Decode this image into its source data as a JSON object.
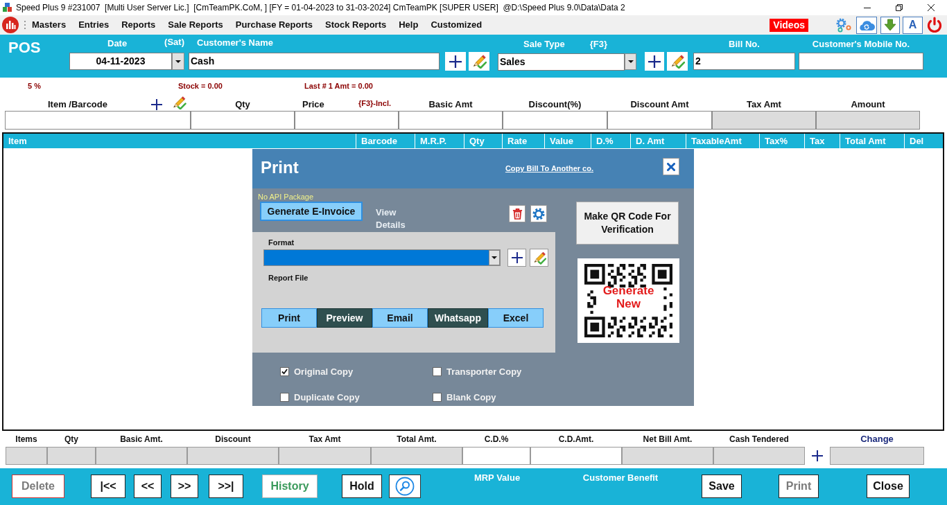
{
  "window": {
    "title": "Speed Plus 9 #231007  [Multi User Server Lic.]  [CmTeamPK.CoM, ] [FY = 01-04-2023 to 31-03-2024] CmTeamPK [SUPER USER]  @D:\\Speed Plus 9.0\\Data\\Data 2"
  },
  "menu": {
    "items": [
      "Masters",
      "Entries",
      "Reports",
      "Sale Reports",
      "Purchase Reports",
      "Stock Reports",
      "Help",
      "Customized"
    ],
    "videos": "Videos",
    "font_button": "A"
  },
  "pos_header": {
    "title": "POS",
    "date": {
      "label": "Date",
      "weekday": "(Sat)",
      "value": "04-11-2023"
    },
    "customer_name": {
      "label": "Customer's Name",
      "value": "Cash"
    },
    "sale_type": {
      "label": "Sale Type",
      "hint": "{F3}",
      "value": "Sales"
    },
    "bill_no": {
      "label": "Bill No.",
      "value": "2"
    },
    "customer_mobile": {
      "label": "Customer's Mobile No."
    }
  },
  "info_line": [
    "5 %",
    "Stock = 0.00",
    "Last # 1 Amt = 0.00"
  ],
  "entry_fields": [
    {
      "label": "Item /Barcode",
      "kind": "lookup",
      "disabled": false
    },
    {
      "label": "Qty",
      "kind": "plain",
      "disabled": false
    },
    {
      "label": "Price",
      "kind": "price",
      "hint": "{F3}-Incl.",
      "disabled": false
    },
    {
      "label": "Basic Amt",
      "kind": "plain",
      "disabled": false
    },
    {
      "label": "Discount(%)",
      "kind": "plain",
      "disabled": false
    },
    {
      "label": "Discount Amt",
      "kind": "plain",
      "disabled": false
    },
    {
      "label": "Tax Amt",
      "kind": "plain",
      "disabled": true
    },
    {
      "label": "Amount",
      "kind": "plain",
      "disabled": true
    }
  ],
  "table": {
    "columns": [
      "Item",
      "Barcode",
      "M.R.P.",
      "Qty",
      "Rate",
      "Value",
      "D.%",
      "D. Amt",
      "TaxableAmt",
      "Tax%",
      "Tax",
      "Total Amt",
      "Del"
    ]
  },
  "print_dialog": {
    "title": "Print",
    "link": "Copy Bill To Another co.",
    "notice": "No API Package",
    "einvoice_button": "Generate E-Invoice",
    "view_details": "View Details",
    "qr_button": "Make QR Code For Verification",
    "qr_image_text": "Generate New",
    "format": {
      "label": "Format",
      "focused": true
    },
    "report_file_label": "Report File",
    "actions": [
      {
        "label": "Print",
        "kind": "light"
      },
      {
        "label": "Preview",
        "kind": "dark"
      },
      {
        "label": "Email",
        "kind": "light"
      },
      {
        "label": "Whatsapp",
        "kind": "dark"
      },
      {
        "label": "Excel",
        "kind": "light"
      }
    ],
    "copies": [
      {
        "label": "Original Copy",
        "checked": true
      },
      {
        "label": "Transporter Copy",
        "checked": false
      },
      {
        "label": "Duplicate Copy",
        "checked": false
      },
      {
        "label": "Blank Copy",
        "checked": false
      }
    ]
  },
  "totals": [
    {
      "label": "Items",
      "kind": "plain",
      "disabled": true
    },
    {
      "label": "Qty",
      "kind": "plain",
      "disabled": true
    },
    {
      "label": "Basic Amt.",
      "kind": "plain",
      "disabled": true
    },
    {
      "label": "Discount",
      "kind": "plain",
      "disabled": true
    },
    {
      "label": "Tax Amt",
      "kind": "plain",
      "disabled": true
    },
    {
      "label": "Total Amt.",
      "kind": "plain",
      "disabled": true
    },
    {
      "label": "C.D.%",
      "kind": "plain",
      "disabled": false
    },
    {
      "label": "C.D.Amt.",
      "kind": "plain",
      "disabled": false
    },
    {
      "label": "Net Bill Amt.",
      "kind": "plain",
      "disabled": true
    },
    {
      "label": "Cash Tendered",
      "kind": "plain",
      "disabled": true
    },
    {
      "label": "Change",
      "kind": "change",
      "disabled": true
    }
  ],
  "footer": [
    {
      "label": "Delete",
      "kind": "danger",
      "disabled": true
    },
    {
      "label": "|<<",
      "kind": "plain",
      "disabled": false
    },
    {
      "label": "<<",
      "kind": "plain",
      "disabled": false
    },
    {
      "label": ">>",
      "kind": "plain",
      "disabled": false
    },
    {
      "label": ">>|",
      "kind": "plain",
      "disabled": false
    },
    {
      "label": "History",
      "kind": "success",
      "disabled": false
    },
    {
      "label": "Hold",
      "kind": "plain",
      "disabled": false
    },
    {
      "kind": "search",
      "disabled": false
    },
    {
      "label": "MRP Value",
      "kind": "label"
    },
    {
      "label": "Customer Benefit",
      "kind": "label"
    },
    {
      "label": "Save",
      "kind": "plain",
      "disabled": false
    },
    {
      "label": "Print",
      "kind": "plain",
      "disabled": true
    },
    {
      "label": "Close",
      "kind": "plain",
      "disabled": false
    }
  ]
}
